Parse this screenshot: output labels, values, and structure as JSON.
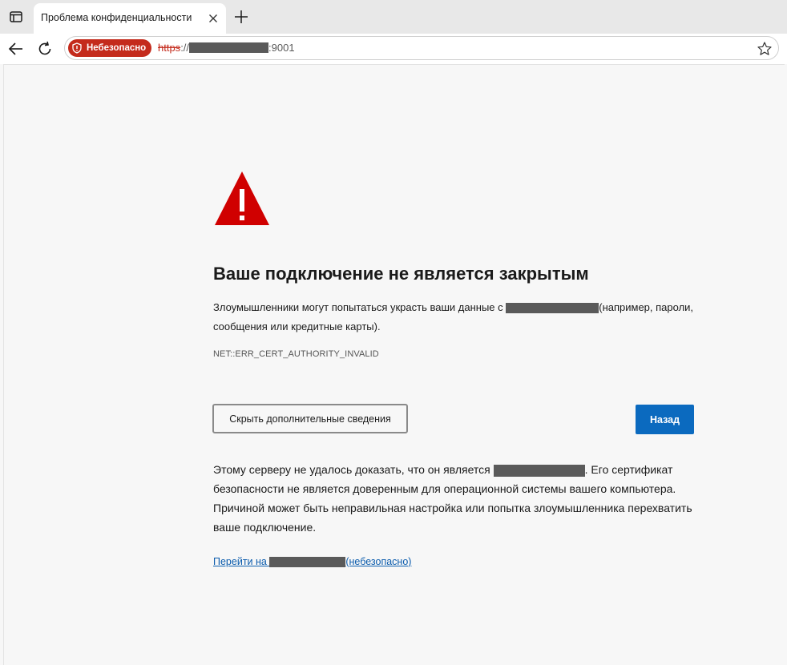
{
  "tab": {
    "title": "Проблема конфиденциальности"
  },
  "address": {
    "security_label": "Небезопасно",
    "scheme": "https",
    "scheme_sep": "://",
    "port": ":9001"
  },
  "main": {
    "heading": "Ваше подключение не является закрытым",
    "explanation_part1": "Злоумышленники могут попытаться украсть ваши данные с ",
    "explanation_part2": "(например, пароли, сообщения или кредитные карты).",
    "error_code": "NET::ERR_CERT_AUTHORITY_INVALID",
    "details_button": "Скрыть дополнительные сведения",
    "back_button": "Назад",
    "details_part1": "Этому серверу не удалось доказать, что он является ",
    "details_part2": ". Его сертификат безопасности не является доверенным для операционной системы вашего компьютера. Причиной может быть неправильная настройка или попытка злоумышленника перехватить ваше подключение.",
    "proceed_prefix": "Перейти на ",
    "proceed_suffix": "(небезопасно)"
  },
  "icons": {
    "tab_actions": "tab-actions-icon",
    "tab_close": "close-icon",
    "new_tab": "plus-icon",
    "back": "arrow-left-icon",
    "reload": "reload-icon",
    "insecure": "shield-warning-icon",
    "favorite": "star-icon",
    "warning": "warning-triangle-icon"
  },
  "colors": {
    "insecure_red": "#c42b1c",
    "warning_red": "#d00000",
    "primary_blue": "#0b6abf",
    "link_blue": "#0b5cad",
    "page_bg": "#f7f7f7"
  }
}
